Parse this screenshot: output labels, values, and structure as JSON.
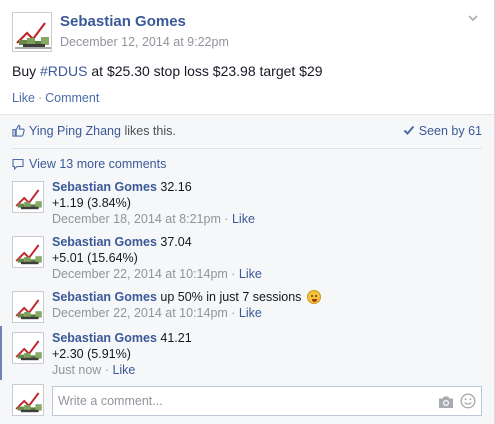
{
  "post": {
    "author": "Sebastian Gomes",
    "timestamp": "December 12, 2014 at 9:22pm",
    "text_before": "Buy ",
    "hashtag": "#RDUS",
    "text_after": " at $25.30 stop loss $23.98 target $29",
    "actions": {
      "like": "Like",
      "separator": "·",
      "comment": "Comment"
    }
  },
  "likes": {
    "liker": "Ying Ping Zhang",
    "suffix": " likes this.",
    "seen_by": "Seen by 61"
  },
  "view_more": "View 13 more comments",
  "comments": [
    {
      "author": "Sebastian Gomes",
      "line1": " 32.16",
      "line2": "+1.19 (3.84%)",
      "time": "December 18, 2014 at 8:21pm",
      "sep": " · ",
      "like": "Like"
    },
    {
      "author": "Sebastian Gomes",
      "line1": " 37.04",
      "line2": "+5.01 (15.64%)",
      "time": "December 22, 2014 at 10:14pm",
      "sep": " · ",
      "like": "Like"
    },
    {
      "author": "Sebastian Gomes",
      "line1": " up 50% in just 7 sessions ",
      "time": "December 22, 2014 at 10:14pm",
      "sep": " · ",
      "like": "Like"
    },
    {
      "author": "Sebastian Gomes",
      "line1": " 41.21",
      "line2": "+2.30 (5.91%)",
      "time": "Just now",
      "sep": " · ",
      "like": "Like"
    }
  ],
  "composer": {
    "placeholder": "Write a comment..."
  },
  "colors": {
    "link": "#3b5998",
    "meta": "#90949c",
    "ufi_bg": "#f6f7f9"
  },
  "icons": [
    "chevron-down-icon",
    "thumbs-up-icon",
    "checkmark-icon",
    "comment-bubble-icon",
    "camera-icon",
    "smiley-icon"
  ]
}
